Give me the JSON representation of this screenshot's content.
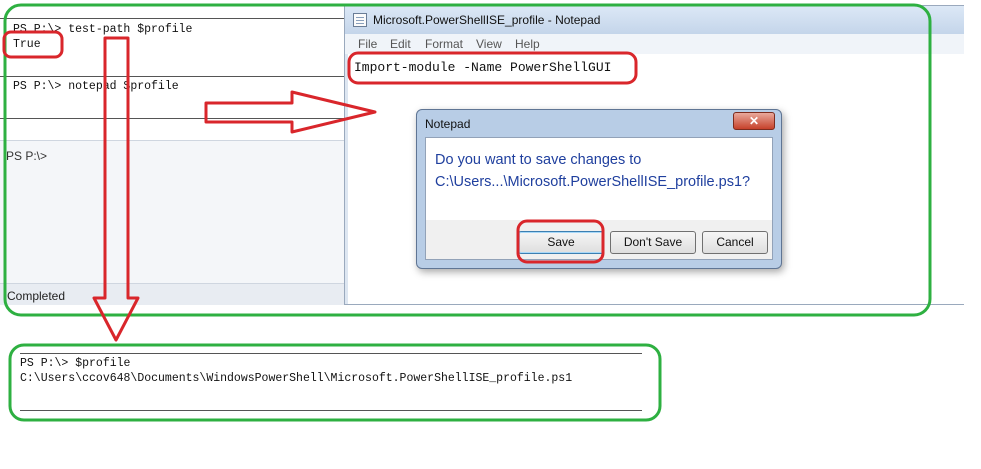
{
  "ise": {
    "line1": "PS P:\\> test-path $profile",
    "line2": "True",
    "line3": "PS P:\\> notepad $profile",
    "console_prompt": "PS P:\\>",
    "status": "Completed"
  },
  "notepad": {
    "title": "Microsoft.PowerShellISE_profile - Notepad",
    "menu": [
      "File",
      "Edit",
      "Format",
      "View",
      "Help"
    ],
    "content": "Import-module -Name PowerShellGUI"
  },
  "dialog": {
    "title": "Notepad",
    "close_glyph": "✕",
    "message_line1": "Do you want to save changes to",
    "message_line2": "C:\\Users...\\Microsoft.PowerShellISE_profile.ps1?",
    "save_label": "Save",
    "dont_save_label": "Don't Save",
    "cancel_label": "Cancel"
  },
  "profile_output": {
    "line1": "PS P:\\> $profile",
    "line2": "C:\\Users\\ccov648\\Documents\\WindowsPowerShell\\Microsoft.PowerShellISE_profile.ps1"
  },
  "annotation_colors": {
    "highlight_red": "#d9262b",
    "highlight_green": "#2eb041"
  }
}
